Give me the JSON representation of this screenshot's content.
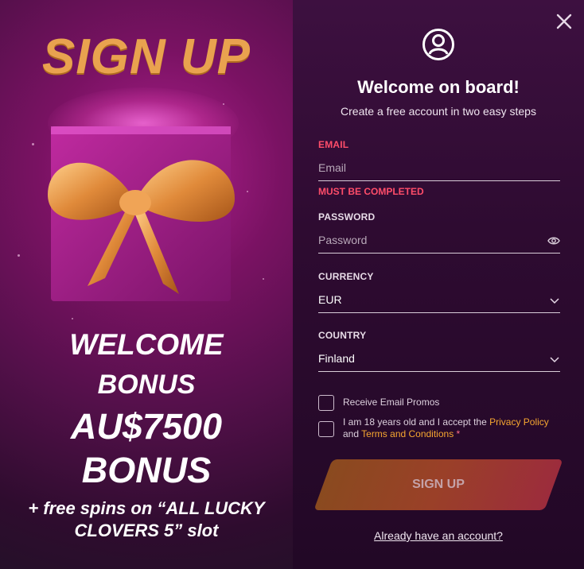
{
  "promo": {
    "title": "SIGN UP",
    "line1": "WELCOME",
    "line2": "BONUS",
    "line3": "AU$7500",
    "line4": "BONUS",
    "line5a": "+ free spins on “ALL LUCKY",
    "line5b": "CLOVERS 5” slot"
  },
  "form": {
    "welcome": "Welcome on board!",
    "subtitle": "Create a free account in two easy steps",
    "email": {
      "label": "EMAIL",
      "placeholder": "Email",
      "error": "MUST BE COMPLETED"
    },
    "password": {
      "label": "PASSWORD",
      "placeholder": "Password"
    },
    "currency": {
      "label": "CURRENCY",
      "value": "EUR"
    },
    "country": {
      "label": "COUNTRY",
      "value": "Finland"
    },
    "promos_label": "Receive Email Promos",
    "terms": {
      "prefix": "I am 18 years old and I accept the ",
      "privacy": "Privacy Policy",
      "and": "and ",
      "terms": "Terms and Conditions",
      "required": "*"
    },
    "submit": "SIGN UP",
    "already": "Already have an account?"
  },
  "icons": {
    "close": "close-icon",
    "user": "user-circle-icon",
    "eye": "eye-icon",
    "chevron": "chevron-down-icon"
  },
  "colors": {
    "accent_gold": "#e9a24f",
    "error": "#ff4d6a",
    "link": "#f6a630",
    "panel_bg": "#2e0b31"
  }
}
